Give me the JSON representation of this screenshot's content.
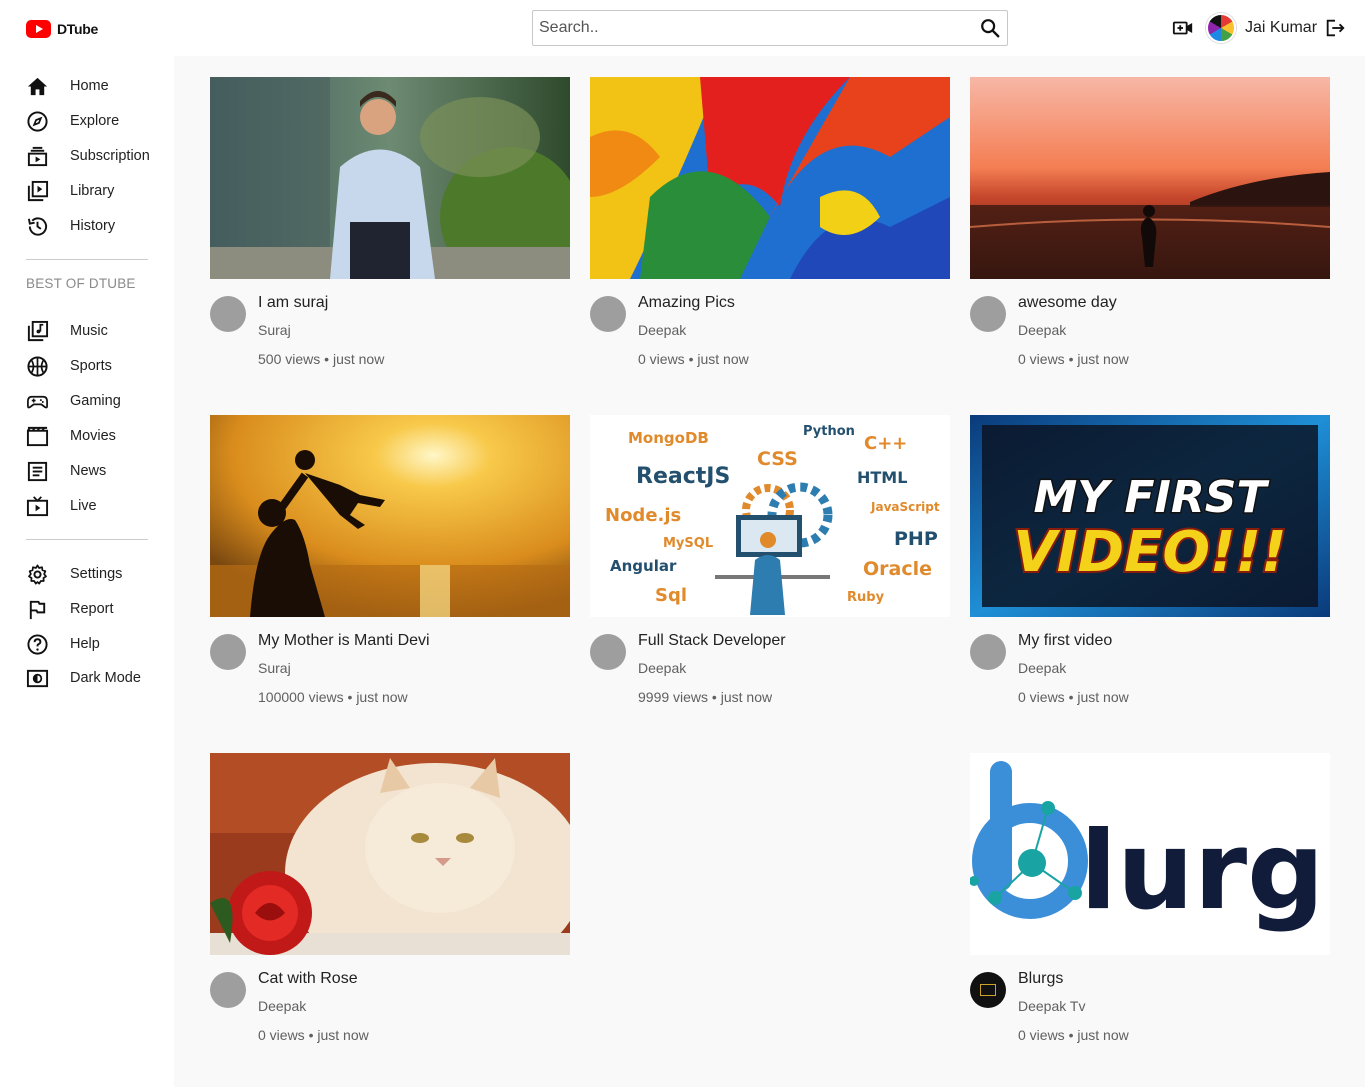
{
  "app": {
    "name": "DTube"
  },
  "search": {
    "placeholder": "Search.."
  },
  "user": {
    "name": "Jai Kumar"
  },
  "sidebar": {
    "primary": [
      {
        "label": "Home",
        "icon": "home-icon"
      },
      {
        "label": "Explore",
        "icon": "compass-icon"
      },
      {
        "label": "Subscription",
        "icon": "subscriptions-icon"
      },
      {
        "label": "Library",
        "icon": "library-icon"
      },
      {
        "label": "History",
        "icon": "history-icon"
      }
    ],
    "best_title": "BEST OF DTUBE",
    "best": [
      {
        "label": "Music",
        "icon": "music-icon"
      },
      {
        "label": "Sports",
        "icon": "sports-icon"
      },
      {
        "label": "Gaming",
        "icon": "gamepad-icon"
      },
      {
        "label": "Movies",
        "icon": "movie-icon"
      },
      {
        "label": "News",
        "icon": "news-icon"
      },
      {
        "label": "Live",
        "icon": "live-tv-icon"
      }
    ],
    "secondary": [
      {
        "label": "Settings",
        "icon": "gear-icon"
      },
      {
        "label": "Report",
        "icon": "flag-icon"
      },
      {
        "label": "Help",
        "icon": "help-icon"
      },
      {
        "label": "Dark Mode",
        "icon": "brightness-icon"
      }
    ]
  },
  "videos": [
    {
      "title": "I am suraj",
      "channel": "Suraj",
      "views": "500 views",
      "time": "just now",
      "thumb": "man in white shirt"
    },
    {
      "title": "Amazing Pics",
      "channel": "Deepak",
      "views": "0 views",
      "time": "just now",
      "thumb": "colorful feathers"
    },
    {
      "title": "awesome day",
      "channel": "Deepak",
      "views": "0 views",
      "time": "just now",
      "thumb": "sunset silhouette"
    },
    {
      "title": "My Mother is Manti Devi",
      "channel": "Suraj",
      "views": "100000 views",
      "time": "just now",
      "thumb": "mother and child at sunset"
    },
    {
      "title": "Full Stack Developer",
      "channel": "Deepak",
      "views": "9999 views",
      "time": "just now",
      "thumb": "tech word cloud"
    },
    {
      "title": "My first video",
      "channel": "Deepak",
      "views": "0 views",
      "time": "just now",
      "thumb": "my first video banner"
    },
    {
      "title": "Cat with Rose",
      "channel": "Deepak",
      "views": "0 views",
      "time": "just now",
      "thumb": "cat with red rose"
    },
    {
      "title": "Blurgs",
      "channel": "Deepak Tv",
      "views": "0 views",
      "time": "just now",
      "thumb": "blurgs logo"
    }
  ],
  "thumb_text": {
    "tech": {
      "w1": "MongoDB",
      "w2": "Python",
      "w3": "C++",
      "w4": "CSS",
      "w5": "ReactJS",
      "w6": "HTML",
      "w7": "JavaScript",
      "w8": "Node.js",
      "w9": "PHP",
      "w10": "MySQL",
      "w11": "Angular",
      "w12": "Oracle",
      "w13": "Sql",
      "w14": "Ruby"
    },
    "banner": {
      "line1": "MY FIRST",
      "line2": "VIDEO!!!"
    },
    "logo": {
      "text": "lurgs"
    }
  },
  "colors": {
    "brand_red": "#ff0000",
    "page_bg": "#f9f9f9",
    "meta_text": "#606060"
  }
}
